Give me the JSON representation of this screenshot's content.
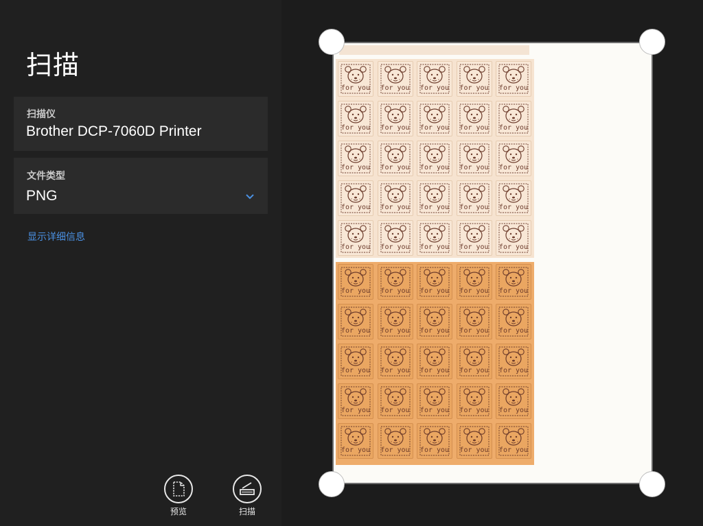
{
  "app": {
    "title": "扫描"
  },
  "scanner": {
    "label": "扫描仪",
    "value": "Brother DCP-7060D Printer"
  },
  "file_type": {
    "label": "文件类型",
    "value": "PNG",
    "options_visible": [
      "PNG"
    ]
  },
  "details_link": {
    "label": "显示详细信息"
  },
  "actions": {
    "preview": {
      "label": "预览",
      "icon": "document-preview-icon"
    },
    "scan": {
      "label": "扫描",
      "icon": "scanner-icon"
    }
  },
  "preview": {
    "sticker_text": "for you",
    "sticker_columns": 5,
    "light_rows": 5,
    "orange_rows": 5
  },
  "colors": {
    "accent": "#4a90e2",
    "panel": "#2b2b2b",
    "background": "#1f1f1f",
    "sticker_light": "#f8e7d6",
    "sticker_orange": "#eaa661",
    "ink": "#6b3a2a"
  }
}
